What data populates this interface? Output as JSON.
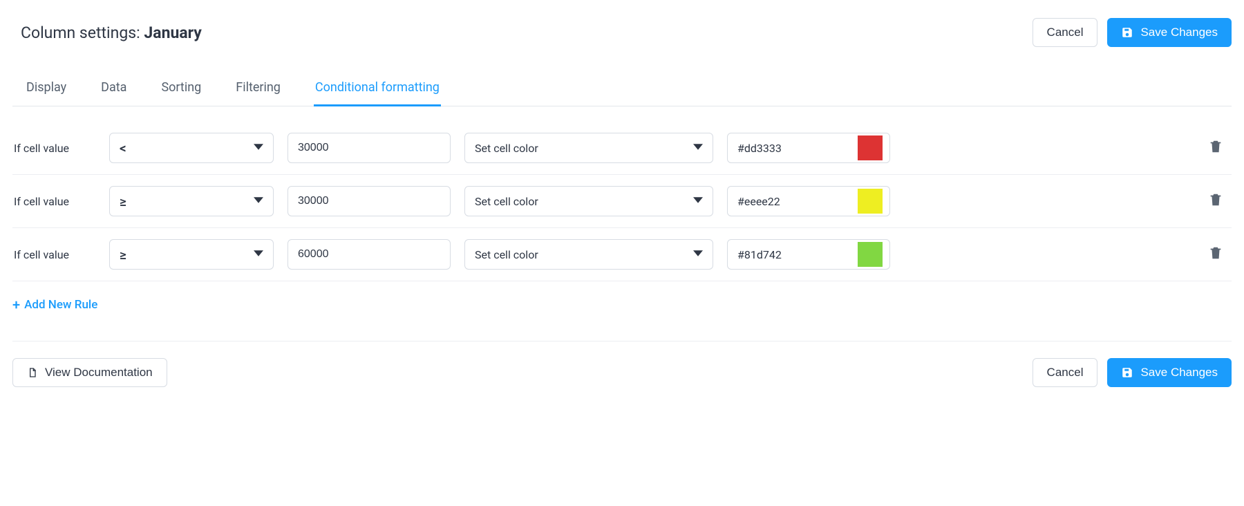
{
  "header": {
    "title_prefix": "Column settings: ",
    "title_value": "January",
    "cancel_label": "Cancel",
    "save_label": "Save Changes"
  },
  "tabs": [
    {
      "label": "Display",
      "active": false
    },
    {
      "label": "Data",
      "active": false
    },
    {
      "label": "Sorting",
      "active": false
    },
    {
      "label": "Filtering",
      "active": false
    },
    {
      "label": "Conditional formatting",
      "active": true
    }
  ],
  "rule_label": "If cell value",
  "rules": [
    {
      "operator": "<",
      "value": "30000",
      "action": "Set cell color",
      "color_hex": "#dd3333",
      "swatch": "#dd3333"
    },
    {
      "operator": "≥",
      "value": "30000",
      "action": "Set cell color",
      "color_hex": "#eeee22",
      "swatch": "#eeee22"
    },
    {
      "operator": "≥",
      "value": "60000",
      "action": "Set cell color",
      "color_hex": "#81d742",
      "swatch": "#81d742"
    }
  ],
  "add_rule_label": "Add New Rule",
  "footer": {
    "doc_label": "View Documentation",
    "cancel_label": "Cancel",
    "save_label": "Save Changes"
  }
}
